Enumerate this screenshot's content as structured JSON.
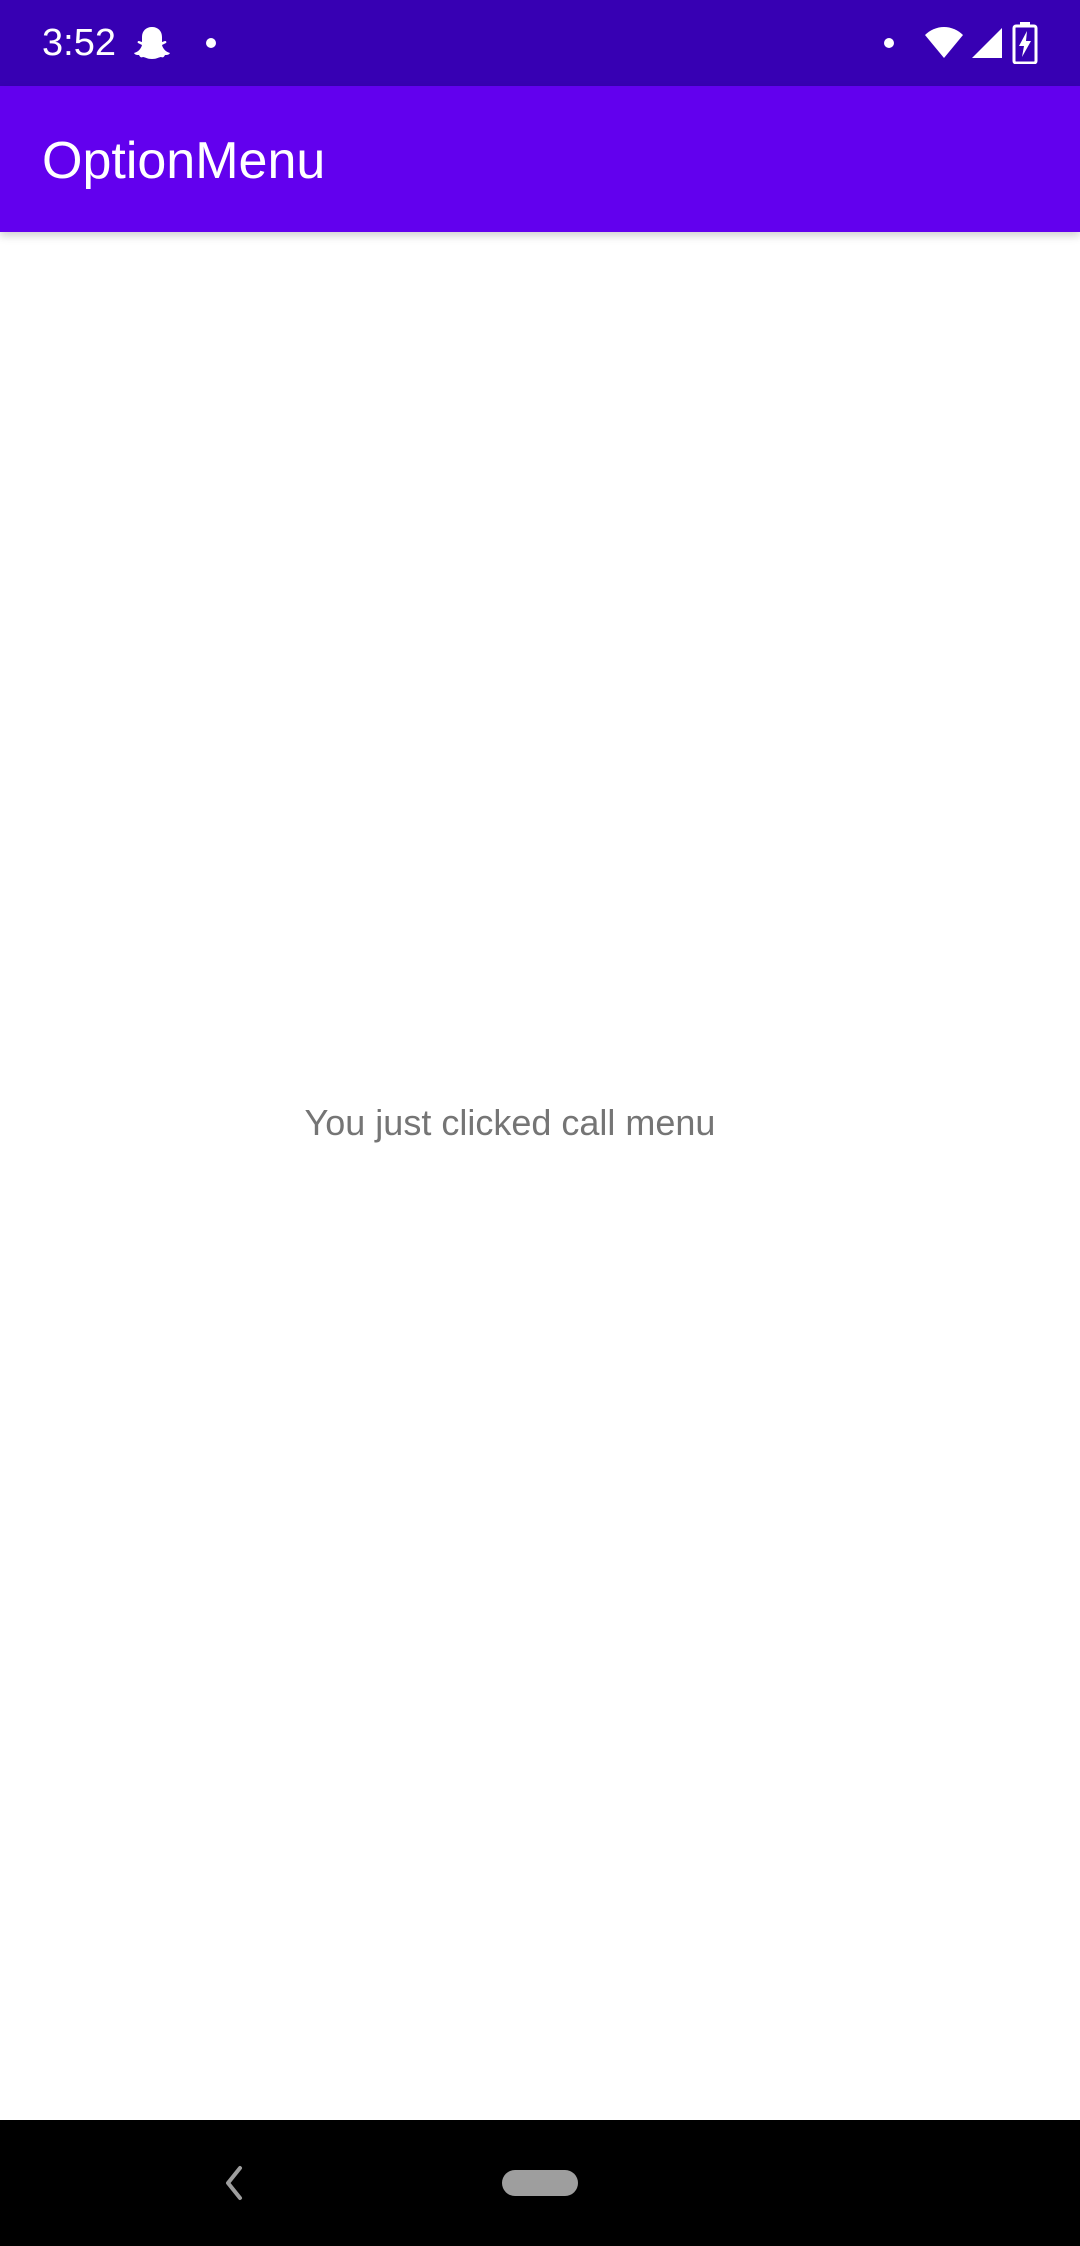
{
  "status_bar": {
    "time": "3:52",
    "icons": [
      "snapchat-ghost-icon",
      "notification-dot-icon",
      "notification-dot-icon",
      "wifi-icon",
      "cell-signal-icon",
      "battery-charging-icon"
    ],
    "background_color": "#3700b3"
  },
  "app_bar": {
    "title": "OptionMenu",
    "background_color": "#6200ee"
  },
  "main": {
    "message": "You just clicked call menu"
  },
  "nav_bar": {
    "icons": [
      "back-icon",
      "home-pill-icon"
    ]
  }
}
